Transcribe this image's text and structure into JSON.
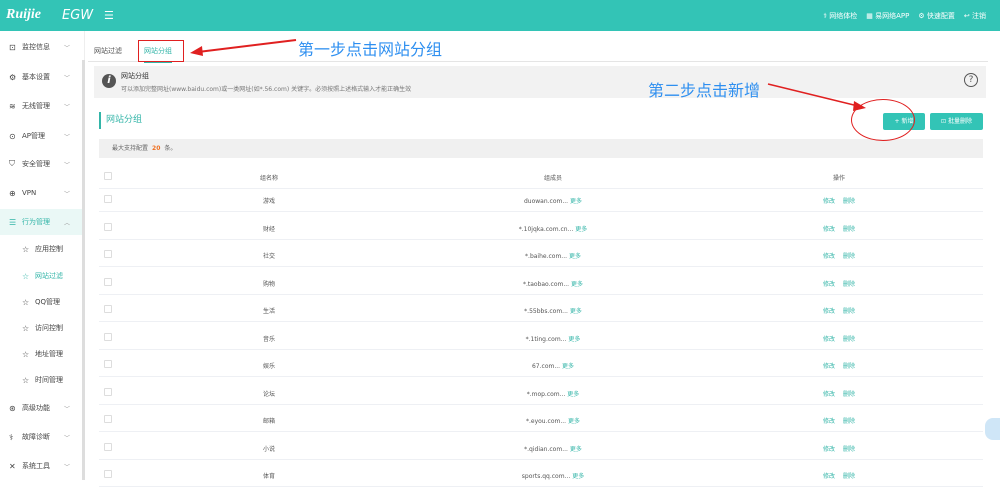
{
  "header": {
    "logo": "Ruijie",
    "product": "EGW",
    "links": [
      {
        "icon": "stethoscope-icon",
        "label": "网络体检"
      },
      {
        "icon": "phone-icon",
        "label": "易网络APP"
      },
      {
        "icon": "gear-icon",
        "label": "快速配置"
      },
      {
        "icon": "logout-icon",
        "label": "注销"
      }
    ]
  },
  "sidebar": {
    "items": [
      {
        "label": "监控信息",
        "icon": "monitor-icon",
        "g": "⊡"
      },
      {
        "label": "基本设置",
        "icon": "gear-icon",
        "g": "⚙"
      },
      {
        "label": "无线管理",
        "icon": "wifi-icon",
        "g": "≋"
      },
      {
        "label": "AP管理",
        "icon": "ap-icon",
        "g": "⊙"
      },
      {
        "label": "安全管理",
        "icon": "shield-icon",
        "g": "⛉"
      },
      {
        "label": "VPN",
        "icon": "vpn-icon",
        "g": "⊕"
      },
      {
        "label": "行为管理",
        "icon": "behavior-icon",
        "g": "☰"
      },
      {
        "label": "应用控制",
        "icon": "star-icon",
        "g": "☆"
      },
      {
        "label": "网站过滤",
        "icon": "star-icon",
        "g": "☆"
      },
      {
        "label": "QQ管理",
        "icon": "star-icon",
        "g": "☆"
      },
      {
        "label": "访问控制",
        "icon": "star-icon",
        "g": "☆"
      },
      {
        "label": "地址管理",
        "icon": "star-icon",
        "g": "☆"
      },
      {
        "label": "时间管理",
        "icon": "star-icon",
        "g": "☆"
      },
      {
        "label": "高级功能",
        "icon": "advanced-icon",
        "g": "⊛"
      },
      {
        "label": "故障诊断",
        "icon": "diagnose-icon",
        "g": "⚕"
      },
      {
        "label": "系统工具",
        "icon": "tools-icon",
        "g": "✕"
      }
    ]
  },
  "tabs": [
    "网站过滤",
    "网站分组"
  ],
  "info": {
    "title": "网站分组",
    "text": "可以添加完整网址(www.baidu.com)或一类网址(如*.56.com) 关键字。必须按照上述格式输入才能正确生效"
  },
  "section_title": "网站分组",
  "buttons": {
    "add": "+ 新增",
    "batch_delete": "⊡ 批量删除"
  },
  "note": {
    "prefix": "最大支持配置",
    "count": "20",
    "suffix": "条。"
  },
  "table": {
    "headers": [
      "组名称",
      "组成员",
      "操作"
    ],
    "more": "更多",
    "edit": "修改",
    "delete": "删除",
    "rows": [
      {
        "name": "游戏",
        "member": "duowan.com..."
      },
      {
        "name": "财经",
        "member": "*.10jqka.com.cn..."
      },
      {
        "name": "社交",
        "member": "*.baihe.com..."
      },
      {
        "name": "购物",
        "member": "*.taobao.com..."
      },
      {
        "name": "生活",
        "member": "*.55bbs.com..."
      },
      {
        "name": "音乐",
        "member": "*.1ting.com..."
      },
      {
        "name": "娱乐",
        "member": "67.com..."
      },
      {
        "name": "论坛",
        "member": "*.mop.com..."
      },
      {
        "name": "邮箱",
        "member": "*.eyou.com..."
      },
      {
        "name": "小说",
        "member": "*.qidian.com..."
      },
      {
        "name": "体育",
        "member": "sports.qq.com..."
      }
    ]
  },
  "annotations": {
    "step1": "第一步点击网站分组",
    "step2": "第二步点击新增"
  }
}
